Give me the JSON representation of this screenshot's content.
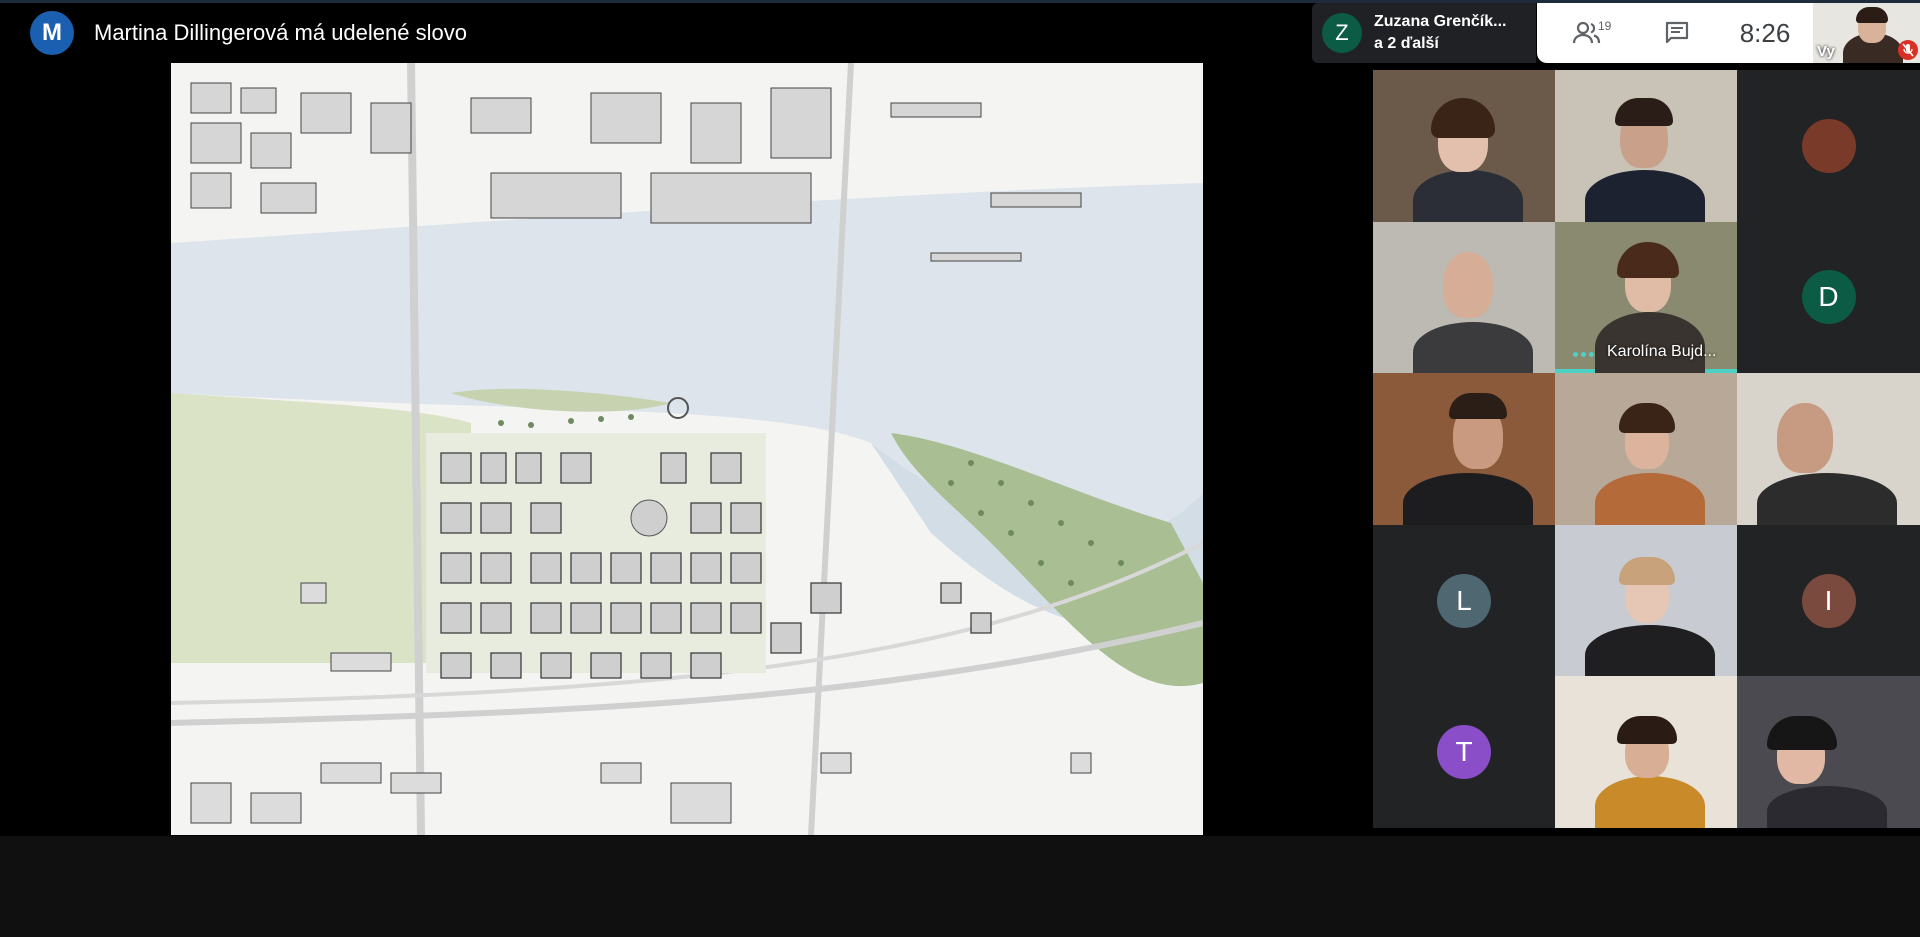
{
  "header": {
    "presenter_initial": "M",
    "presenter_text": "Martina Dillingerová má udelené slovo",
    "avatar_color": "#1a5fb0"
  },
  "speaker_chip": {
    "initial": "Z",
    "name": "Zuzana Grenčík...",
    "others": "a 2 ďalší",
    "avatar_color": "#0b5b45"
  },
  "controls": {
    "people_icon": "people-icon",
    "participant_count": "19",
    "chat_icon": "chat-icon",
    "time": "8:26"
  },
  "self_view": {
    "label": "Vy",
    "mic_icon": "mic-off-icon"
  },
  "tiles": [
    {
      "kind": "video",
      "name": ""
    },
    {
      "kind": "video",
      "name": ""
    },
    {
      "kind": "avatar-image",
      "name": ""
    },
    {
      "kind": "video",
      "name": ""
    },
    {
      "kind": "video",
      "name": "Karolína Bujd...",
      "speaking": true
    },
    {
      "kind": "initial",
      "initial": "D",
      "color": "#0b5b45"
    },
    {
      "kind": "video",
      "name": ""
    },
    {
      "kind": "video",
      "name": ""
    },
    {
      "kind": "video",
      "name": ""
    },
    {
      "kind": "initial",
      "initial": "L",
      "color": "#4f6770"
    },
    {
      "kind": "video",
      "name": ""
    },
    {
      "kind": "initial",
      "initial": "I",
      "color": "#7a4a3e"
    },
    {
      "kind": "initial",
      "initial": "T",
      "color": "#8a4fc8"
    },
    {
      "kind": "video",
      "name": ""
    },
    {
      "kind": "video",
      "name": ""
    }
  ]
}
